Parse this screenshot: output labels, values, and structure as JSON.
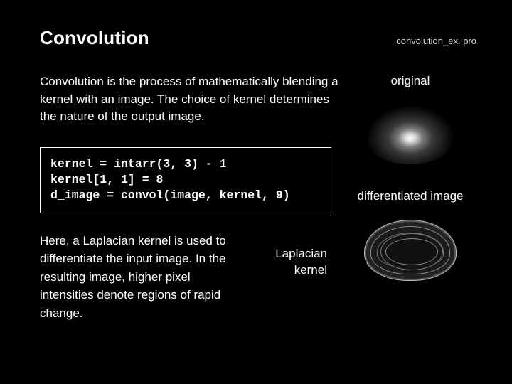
{
  "header": {
    "title": "Convolution",
    "source_file": "convolution_ex. pro"
  },
  "left": {
    "intro": "Convolution is the process of mathematically blending a kernel with an image. The choice of kernel determines the nature of the output image.",
    "code": "kernel = intarr(3, 3) - 1\nkernel[1, 1] = 8\nd_image = convol(image, kernel, 9)",
    "explain": "Here, a Laplacian kernel is used to differentiate the input image. In the resulting image, higher pixel intensities denote regions of rapid change.",
    "kernel_caption": "Laplacian kernel"
  },
  "right": {
    "caption_original": "original",
    "caption_diff": "differentiated image"
  }
}
